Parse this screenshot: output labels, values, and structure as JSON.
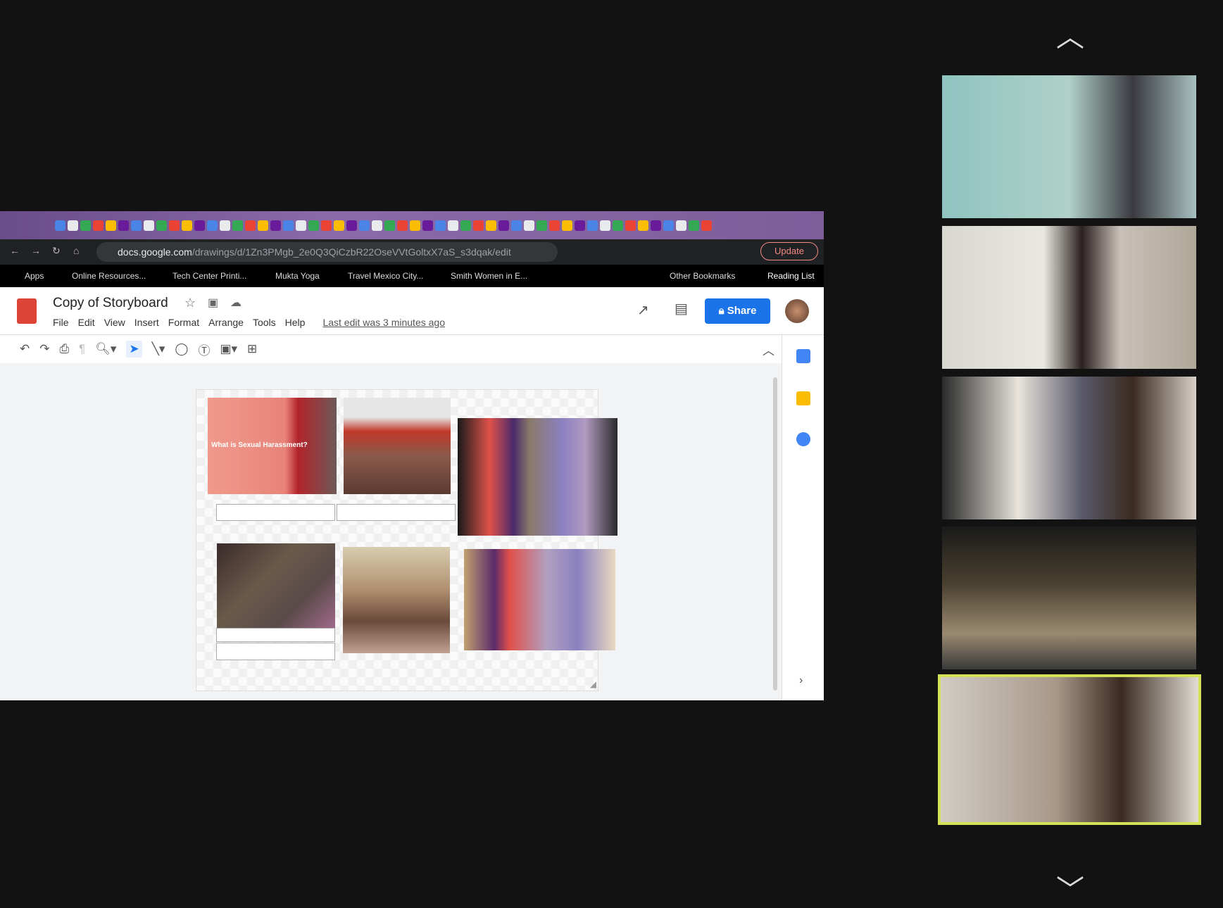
{
  "browser": {
    "url_host": "docs.google.com",
    "url_path": "/drawings/d/1Zn3PMgb_2e0Q3QiCzbR22OseVVtGoltxX7aS_s3dqak/edit",
    "update_label": "Update",
    "bookmarks": [
      "Apps",
      "Online Resources...",
      "Tech Center Printi...",
      "Mukta Yoga",
      "Travel Mexico City...",
      "Smith Women in E..."
    ],
    "other_bookmarks": "Other Bookmarks",
    "reading_list": "Reading List"
  },
  "doc": {
    "title": "Copy of Storyboard",
    "menu": [
      "File",
      "Edit",
      "View",
      "Insert",
      "Format",
      "Arrange",
      "Tools",
      "Help"
    ],
    "last_edit": "Last edit was 3 minutes ago",
    "share_label": "Share"
  },
  "slides": {
    "photo1_text": "What is Sexual Harassment?"
  },
  "colors": {
    "accent": "#1a73e8",
    "active_speaker": "#d4e157",
    "app_icon": "#db4437"
  }
}
